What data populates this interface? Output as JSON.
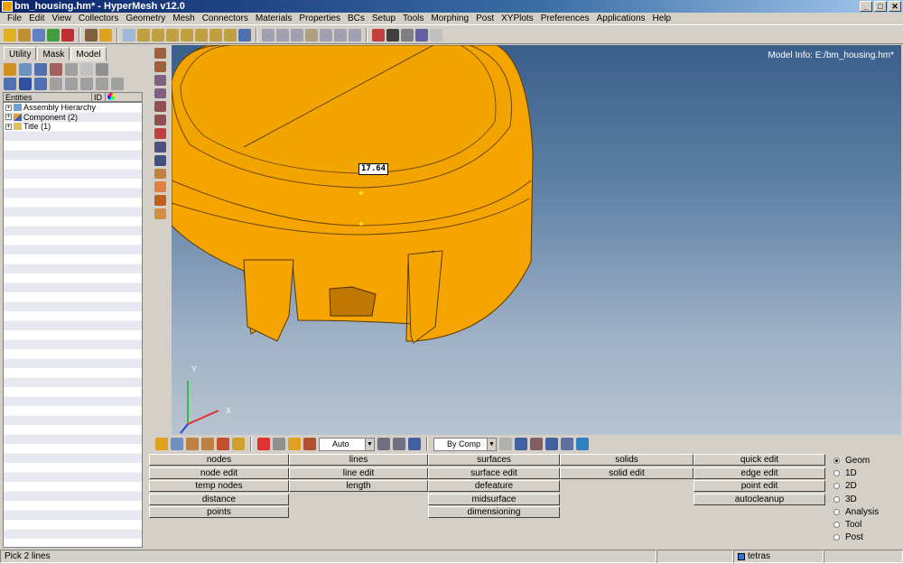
{
  "window": {
    "title": "bm_housing.hm* - HyperMesh v12.0",
    "buttons": [
      "_",
      "□",
      "✕"
    ]
  },
  "menu": [
    "File",
    "Edit",
    "View",
    "Collectors",
    "Geometry",
    "Mesh",
    "Connectors",
    "Materials",
    "Properties",
    "BCs",
    "Setup",
    "Tools",
    "Morphing",
    "Post",
    "XYPlots",
    "Preferences",
    "Applications",
    "Help"
  ],
  "tabs": [
    "Utility",
    "Mask",
    "Model"
  ],
  "entities": {
    "headers": [
      "Entities",
      "ID"
    ],
    "rows": [
      "Assembly Hierarchy",
      "Component (2)",
      "Title (1)"
    ]
  },
  "viewport": {
    "model_info": "Model Info: E:/bm_housing.hm*",
    "measure": "17.64",
    "axis_y": "Y",
    "axis_x": "X"
  },
  "toolbar": {
    "display_mode": "Auto",
    "color_mode": "By Comp"
  },
  "panel": {
    "col1": [
      "nodes",
      "node edit",
      "temp nodes",
      "distance",
      "points"
    ],
    "col2": [
      "lines",
      "line edit",
      "length"
    ],
    "col3": [
      "surfaces",
      "surface edit",
      "defeature",
      "midsurface",
      "dimensioning"
    ],
    "col4": [
      "solids",
      "solid edit"
    ],
    "col5": [
      "quick edit",
      "edge edit",
      "point edit",
      "autocleanup"
    ]
  },
  "pages": [
    "Geom",
    "1D",
    "2D",
    "3D",
    "Analysis",
    "Tool",
    "Post"
  ],
  "selected_page": "Geom",
  "status": {
    "message": "Pick 2 lines",
    "component": "tetras"
  },
  "colors": {
    "model": "#f5a400",
    "bg_top": "#3b5f8c",
    "bg_bottom": "#b8c4d0"
  }
}
